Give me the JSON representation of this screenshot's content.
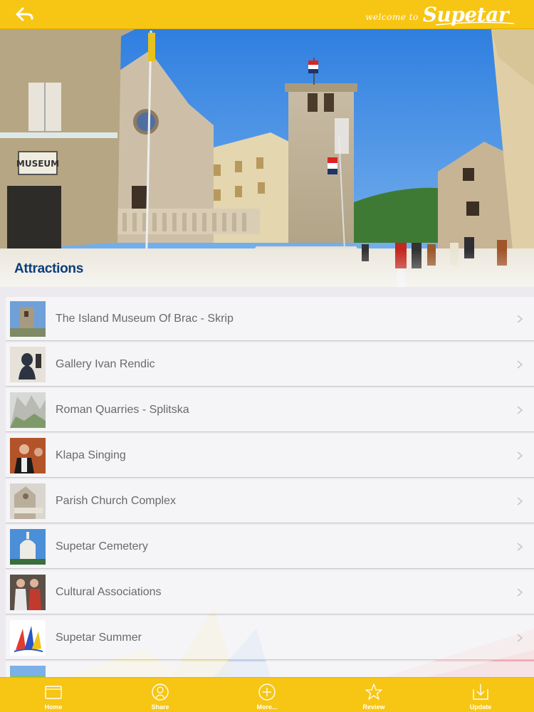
{
  "header": {
    "back_icon": "back-arrow-icon",
    "welcome_prefix": "welcome to",
    "brand": "Supetar"
  },
  "hero": {
    "sign_text": "MUSEUM",
    "section_title": "Attractions"
  },
  "attractions": [
    {
      "label": "The Island Museum Of Brac - Skrip",
      "thumb": "museum-tower-thumb"
    },
    {
      "label": "Gallery Ivan Rendic",
      "thumb": "sculpture-thumb"
    },
    {
      "label": "Roman Quarries - Splitska",
      "thumb": "quarry-thumb"
    },
    {
      "label": "Klapa Singing",
      "thumb": "singers-thumb"
    },
    {
      "label": "Parish Church Complex",
      "thumb": "church-thumb"
    },
    {
      "label": "Supetar Cemetery",
      "thumb": "cemetery-thumb"
    },
    {
      "label": "Cultural Associations",
      "thumb": "costumes-thumb"
    },
    {
      "label": "Supetar Summer",
      "thumb": "summer-logo-thumb"
    }
  ],
  "tabbar": [
    {
      "label": "Home",
      "icon": "home-icon"
    },
    {
      "label": "Share",
      "icon": "share-icon"
    },
    {
      "label": "More...",
      "icon": "plus-circle-icon"
    },
    {
      "label": "Review",
      "icon": "star-icon"
    },
    {
      "label": "Update",
      "icon": "download-icon"
    }
  ],
  "colors": {
    "accent_yellow": "#f7c513",
    "section_title_blue": "#0b3d7a",
    "row_text": "#6a6a6a"
  }
}
